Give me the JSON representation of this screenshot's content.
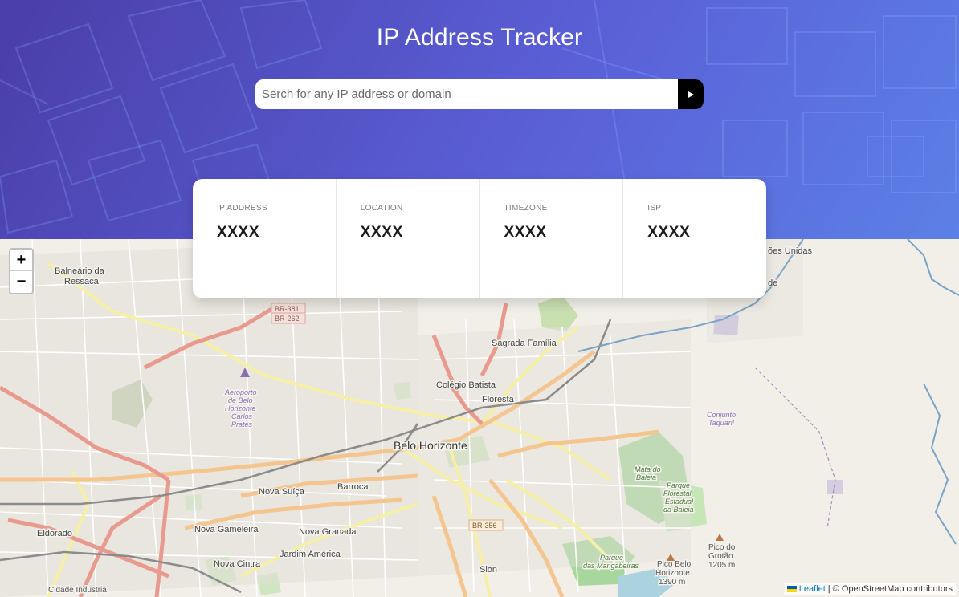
{
  "header": {
    "title": "IP Address Tracker",
    "search": {
      "placeholder": "Serch for any IP address or domain",
      "value": ""
    },
    "submit_icon": "arrow-right-icon"
  },
  "info": [
    {
      "label": "IP ADDRESS",
      "value": "XXXX"
    },
    {
      "label": "LOCATION",
      "value": "XXXX"
    },
    {
      "label": "TIMEZONE",
      "value": "XXXX"
    },
    {
      "label": "ISP",
      "value": "XXXX"
    }
  ],
  "map": {
    "zoom_in": "+",
    "zoom_out": "−",
    "attribution": {
      "leaflet": "Leaflet",
      "separator": "|",
      "text": "© OpenStreetMap contributors"
    },
    "labels": {
      "balneario": "Balneário da",
      "ressaca": "Ressaca",
      "sagrada": "Sagrada Família",
      "colegio": "Colégio Batista",
      "floresta": "Floresta",
      "belo": "Belo Horizonte",
      "nova_suica": "Nova Suíça",
      "barroca": "Barroca",
      "eldorado": "Eldorado",
      "nova_gameleira": "Nova Gameleira",
      "nova_granada": "Nova Granada",
      "jardim_america": "Jardim América",
      "nova_cintra": "Nova Cintra",
      "cidade_industrial": "Cidade Industria",
      "sion": "Sion",
      "pico_grotao": "Pico do",
      "grotao": "Grotão",
      "grotao_alt": "1205 m",
      "pico_bh": "Pico Belo",
      "pico_bh2": "Horizonte",
      "pico_bh_alt": "1390 m",
      "conjunto": "Conjunto",
      "taquaril": "Taquaril",
      "mata_boleia": "Mata do",
      "mata_boleia2": "Baleia",
      "parque": "Parque",
      "parque2": "Florestal",
      "parque3": "Estadual",
      "parque4": "da Baleia",
      "mangabeiras": "Parque",
      "mangabeiras2": "das Mangabeiras",
      "aeroporto": "Aeroporto",
      "aeroporto2": "de Belo",
      "aeroporto3": "Horizonte",
      "aeroporto4": "Carlos",
      "aeroporto5": "Prates",
      "naces": "ões Unidas",
      "de": "de",
      "br381": "BR-381",
      "br262": "BR-262",
      "br356": "BR-356"
    }
  }
}
